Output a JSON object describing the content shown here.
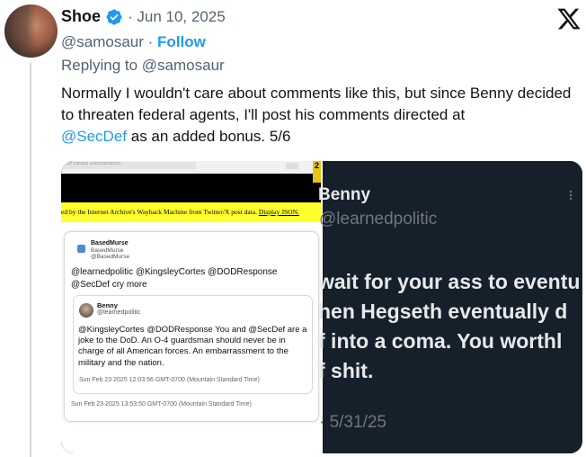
{
  "author": {
    "name": "Shoe",
    "date_line": "· Jun 10, 2025",
    "handle": "@samosaur",
    "separator": "·",
    "follow_label": "Follow"
  },
  "reply": {
    "prefix": "Replying to",
    "to": "@samosaur"
  },
  "tweet": {
    "text_part1": "Normally I wouldn't care about comments like this, but since Benny decided to threaten federal agents, I'll post his comments directed at",
    "mention": "@SecDef",
    "text_part2": "as an added bonus. 5/6"
  },
  "media_left": {
    "side_number": "2",
    "archive_banner_prefix": "ed by the Internet Archive's Wayback Machine from Twitter/X post data.",
    "archive_banner_link": "Display JSON.",
    "outer_post": {
      "name": "BasedMurse",
      "display": "BasedMurse",
      "handle": "@BasedMurse",
      "text": "@learnedpolitic @KingsleyCortes @DODResponse @SecDef cry more",
      "timestamp": "Sun Feb 23 2025 13:53:50 GMT-0700 (Mountain Standard Time)"
    },
    "quoted_post": {
      "name": "Benny",
      "handle": "@learnedpolitic",
      "text": "@KingsleyCortes @DODResponse You and @SecDef are a joke to the DoD. An O-4 guardsman should never be in charge of all American forces. An embarrassment to the military and the nation.",
      "timestamp": "Sun Feb 23 2025 12:03:56 GMT-0700 (Mountain Standard Time)"
    }
  },
  "media_right": {
    "name": "Benny",
    "handle": "@learnedpolitic",
    "lines": [
      "wait for your ass to eventu",
      "hen Hegseth eventually d",
      "f into a coma. You worthl",
      "f shit."
    ],
    "date": "· 5/31/25"
  },
  "colors": {
    "accent": "#1d9bf0",
    "secondary_text": "#536471",
    "highlight": "#ffff2e",
    "dark_bg": "#15202b"
  }
}
